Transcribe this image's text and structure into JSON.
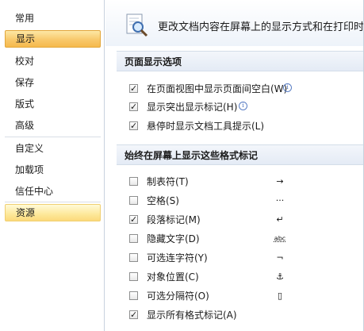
{
  "sidebar": {
    "items": [
      {
        "label": "常用"
      },
      {
        "label": "显示"
      },
      {
        "label": "校对"
      },
      {
        "label": "保存"
      },
      {
        "label": "版式"
      },
      {
        "label": "高级"
      },
      {
        "label": "自定义"
      },
      {
        "label": "加载项"
      },
      {
        "label": "信任中心"
      },
      {
        "label": "资源"
      }
    ],
    "selected": "显示",
    "hovered": "资源"
  },
  "banner": {
    "icon": "magnifier-document-icon",
    "text": "更改文档内容在屏幕上的显示方式和在打印时"
  },
  "page_display": {
    "header": "页面显示选项",
    "options": [
      {
        "label": "在页面视图中显示页面间空白(W)",
        "checked": true,
        "info": true
      },
      {
        "label": "显示突出显示标记(H)",
        "checked": true,
        "info": true
      },
      {
        "label": "悬停时显示文档工具提示(L)",
        "checked": true,
        "info": false
      }
    ]
  },
  "format_marks": {
    "header": "始终在屏幕上显示这些格式标记",
    "options": [
      {
        "label": "制表符(T)",
        "checked": false,
        "mark": "→"
      },
      {
        "label": "空格(S)",
        "checked": false,
        "mark": "···"
      },
      {
        "label": "段落标记(M)",
        "checked": true,
        "mark": "↵"
      },
      {
        "label": "隐藏文字(D)",
        "checked": false,
        "mark": "abc"
      },
      {
        "label": "可选连字符(Y)",
        "checked": false,
        "mark": "¬"
      },
      {
        "label": "对象位置(C)",
        "checked": false,
        "mark": "⚓"
      },
      {
        "label": "可选分隔符(O)",
        "checked": false,
        "mark": "▯"
      },
      {
        "label": "显示所有格式标记(A)",
        "checked": true,
        "mark": ""
      }
    ]
  },
  "colors": {
    "selected_bg": "#f8c96b",
    "hover_bg": "#fde89a",
    "section_bg": "#e4ebf5"
  }
}
